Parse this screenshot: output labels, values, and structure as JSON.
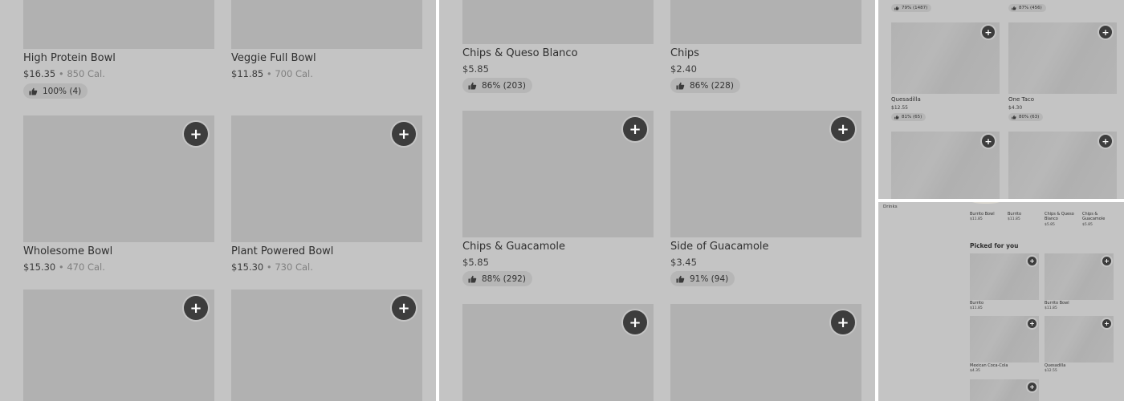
{
  "icons": {
    "add": "plus-icon",
    "rating": "thumbs-up-icon"
  },
  "colors": {
    "panel_background": "#c4c4c4",
    "thumbnail": "#b1b1b1",
    "add_button": "#3d3d3d"
  },
  "panel_a": {
    "items": [
      {
        "name": "High Protein Bowl",
        "price": "$16.35",
        "calories": "850 Cal.",
        "rating": "100% (4)"
      },
      {
        "name": "Veggie Full Bowl",
        "price": "$11.85",
        "calories": "700 Cal."
      },
      {
        "name": "Wholesome Bowl",
        "price": "$15.30",
        "calories": "470 Cal."
      },
      {
        "name": "Plant Powered Bowl",
        "price": "$15.30",
        "calories": "730 Cal."
      }
    ],
    "separator": "•"
  },
  "panel_b": {
    "items": [
      {
        "name": "Chips & Queso Blanco",
        "price": "$5.85",
        "rating": "86% (203)"
      },
      {
        "name": "Chips",
        "price": "$2.40",
        "rating": "86% (228)"
      },
      {
        "name": "Chips & Guacamole",
        "price": "$5.85",
        "rating": "88% (292)"
      },
      {
        "name": "Side of Guacamole",
        "price": "$3.45",
        "rating": "91% (94)"
      }
    ]
  },
  "panel_c": {
    "top_ratings": [
      "79% (1487)",
      "87% (456)"
    ],
    "items": [
      {
        "name": "Quesadilla",
        "price": "$12.55",
        "rating": "81% (65)"
      },
      {
        "name": "One Taco",
        "price": "$4.30",
        "rating": "80% (63)"
      }
    ]
  },
  "panel_d": {
    "sidebar_label": "Drinks",
    "carousel": [
      {
        "name": "Burrito Bowl",
        "price": "$11.85"
      },
      {
        "name": "Burrito",
        "price": "$11.85"
      },
      {
        "name": "Chips & Queso Blanco",
        "price": "$5.85"
      },
      {
        "name": "Chips & Guacamole",
        "price": "$5.85"
      }
    ],
    "section_title": "Picked for you",
    "items": [
      {
        "name": "Burrito",
        "price": "$11.85"
      },
      {
        "name": "Burrito Bowl",
        "price": "$11.85"
      },
      {
        "name": "Mexican Coca-Cola",
        "price": "$4.35"
      },
      {
        "name": "Quesadilla",
        "price": "$12.55"
      }
    ]
  }
}
